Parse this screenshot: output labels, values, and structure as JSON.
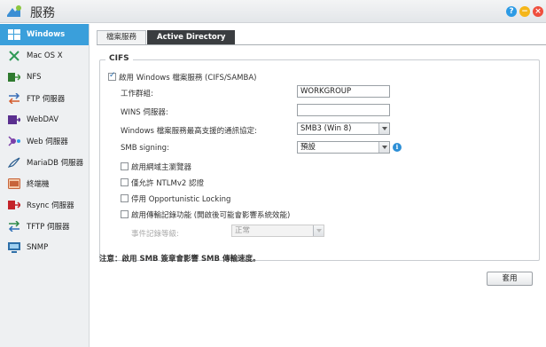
{
  "window": {
    "title": "服務",
    "help_label": "?",
    "minimize_label": "−",
    "close_label": "×"
  },
  "sidebar": {
    "items": [
      {
        "label": "Windows",
        "icon": "windows-icon",
        "active": true
      },
      {
        "label": "Mac OS X",
        "icon": "mac-icon",
        "active": false
      },
      {
        "label": "NFS",
        "icon": "nfs-icon",
        "active": false
      },
      {
        "label": "FTP 伺服器",
        "icon": "ftp-icon",
        "active": false
      },
      {
        "label": "WebDAV",
        "icon": "webdav-icon",
        "active": false
      },
      {
        "label": "Web 伺服器",
        "icon": "web-server-icon",
        "active": false
      },
      {
        "label": "MariaDB 伺服器",
        "icon": "database-icon",
        "active": false
      },
      {
        "label": "終端機",
        "icon": "terminal-icon",
        "active": false
      },
      {
        "label": "Rsync 伺服器",
        "icon": "rsync-icon",
        "active": false
      },
      {
        "label": "TFTP 伺服器",
        "icon": "tftp-icon",
        "active": false
      },
      {
        "label": "SNMP",
        "icon": "snmp-icon",
        "active": false
      }
    ]
  },
  "tabs": [
    {
      "label": "檔案服務",
      "active": false
    },
    {
      "label": "Active Directory",
      "active": true
    }
  ],
  "cifs": {
    "legend": "CIFS",
    "enable_label": "啟用 Windows 檔案服務 (CIFS/SAMBA)",
    "enable_checked": true,
    "workgroup_label": "工作群組:",
    "workgroup_value": "WORKGROUP",
    "wins_label": "WINS 伺服器:",
    "wins_value": "",
    "protocol_label": "Windows 檔案服務最高支援的通訊協定:",
    "protocol_value": "SMB3 (Win 8)",
    "signing_label": "SMB signing:",
    "signing_value": "預設",
    "options": [
      {
        "label": "啟用網域主瀏覽器",
        "checked": false
      },
      {
        "label": "僅允許 NTLMv2 認證",
        "checked": false
      },
      {
        "label": "停用 Opportunistic Locking",
        "checked": false
      },
      {
        "label": "啟用傳輸記錄功能 (開啟後可能會影響系統效能)",
        "checked": false
      }
    ],
    "log_level_label": "事件記錄等級:",
    "log_level_value": "正常"
  },
  "note": "注意：啟用 SMB 簽章會影響 SMB 傳輸速度。",
  "apply_label": "套用",
  "colors": {
    "accent": "#3a9fdb",
    "active_tab": "#3a3d40",
    "help": "#2d9be5",
    "minimize": "#f5b61a",
    "close": "#ef4f3e"
  }
}
